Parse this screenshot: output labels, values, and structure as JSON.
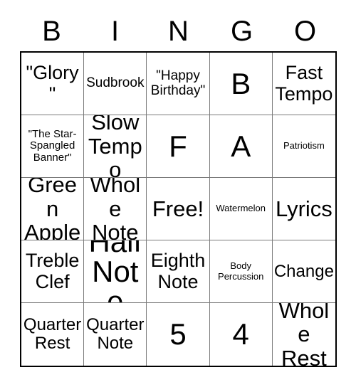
{
  "card": {
    "header": {
      "letters": [
        "B",
        "I",
        "N",
        "G",
        "O"
      ]
    },
    "grid": {
      "rows": 5,
      "columns": 5,
      "cells": [
        {
          "text": "\"Glory\"",
          "size": "lg"
        },
        {
          "text": "Sudbrook",
          "size": "sm"
        },
        {
          "text": "\"Happy Birthday\"",
          "size": "sm"
        },
        {
          "text": "B",
          "size": "xxl"
        },
        {
          "text": "Fast Tempo",
          "size": "lg"
        },
        {
          "text": "\"The Star-Spangled Banner\"",
          "size": "xs"
        },
        {
          "text": "Slow Tempo",
          "size": "xl"
        },
        {
          "text": "F",
          "size": "xxl"
        },
        {
          "text": "A",
          "size": "xxl"
        },
        {
          "text": "Patriotism",
          "size": "xxs"
        },
        {
          "text": "Green Apple",
          "size": "xl"
        },
        {
          "text": "Whole Note",
          "size": "xl"
        },
        {
          "text": "Free!",
          "size": "xl"
        },
        {
          "text": "Watermelon",
          "size": "xxs"
        },
        {
          "text": "Lyrics",
          "size": "xl"
        },
        {
          "text": "Treble Clef",
          "size": "lg"
        },
        {
          "text": "Half Note",
          "size": "xxl"
        },
        {
          "text": "Eighth Note",
          "size": "lg"
        },
        {
          "text": "Body Percussion",
          "size": "xxs"
        },
        {
          "text": "Change",
          "size": "md"
        },
        {
          "text": "Quarter Rest",
          "size": "md"
        },
        {
          "text": "Quarter Note",
          "size": "md"
        },
        {
          "text": "5",
          "size": "xxl"
        },
        {
          "text": "4",
          "size": "xxl"
        },
        {
          "text": "Whole Rest",
          "size": "xl"
        }
      ]
    },
    "colors": {
      "outer_border": "#000000",
      "inner_gridline": "#7a7a7a",
      "text": "#000000",
      "background": "#ffffff"
    }
  }
}
